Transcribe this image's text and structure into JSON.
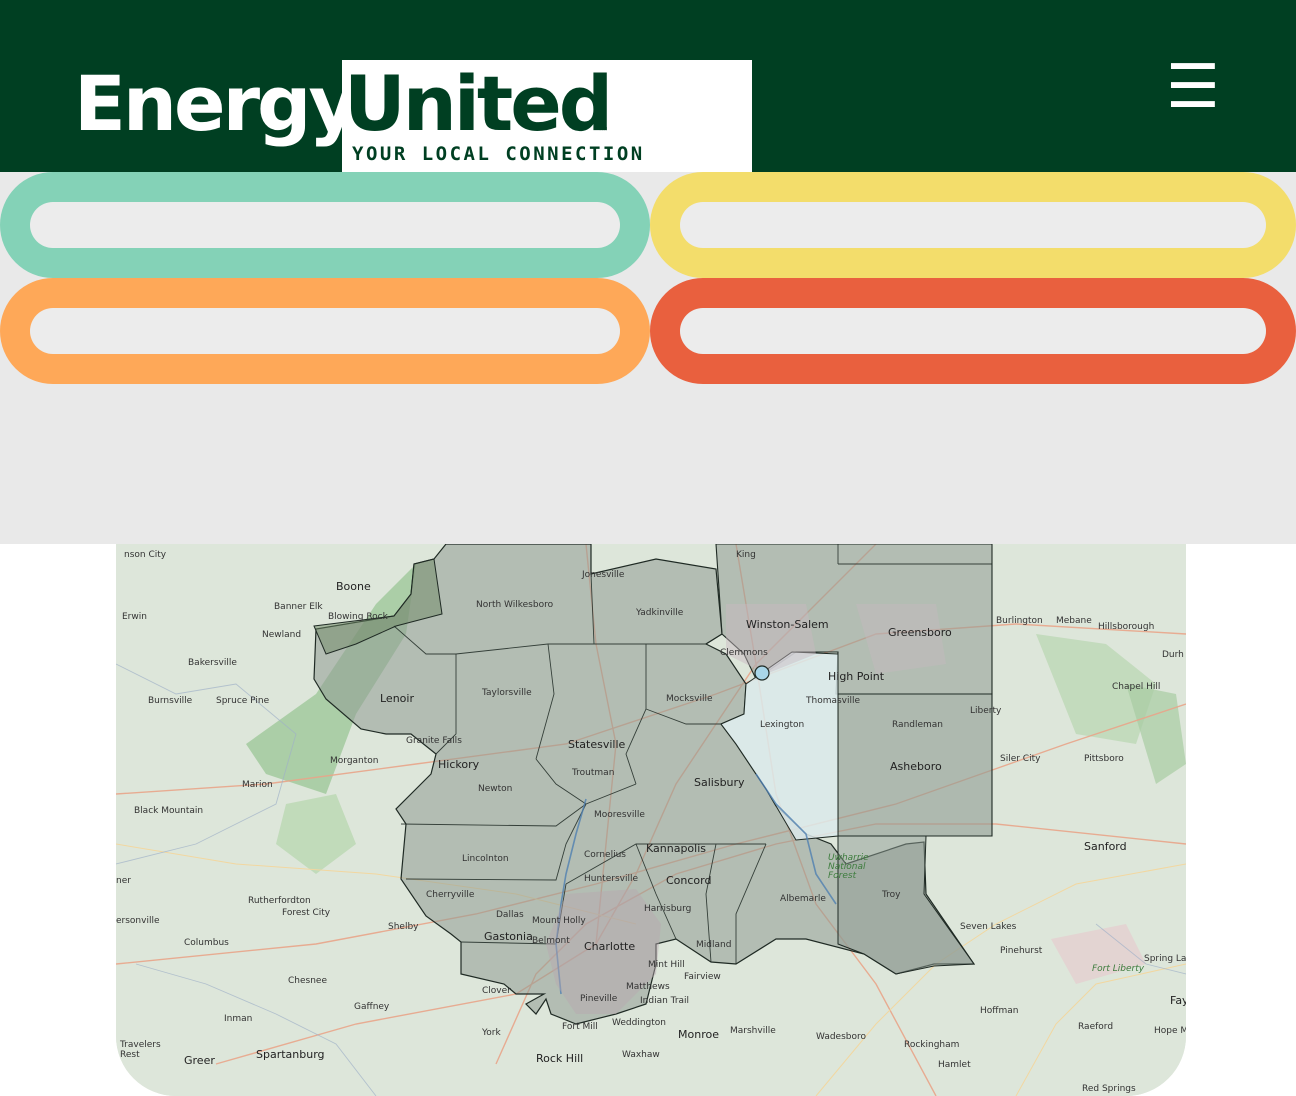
{
  "header": {
    "logo_energy": "Energy",
    "logo_united": "United",
    "logo_tm": "™",
    "tagline": "YOUR LOCAL CONNECTION",
    "menu_icon": "☰"
  },
  "colors": {
    "header_bg": "#003f22",
    "pill_teal": "#84d2b7",
    "pill_yellow": "#f3dd6b",
    "pill_orange": "#fea858",
    "pill_red": "#e9603e"
  },
  "search_fields": [
    {
      "value": "",
      "placeholder": ""
    },
    {
      "value": "",
      "placeholder": ""
    },
    {
      "value": "",
      "placeholder": ""
    },
    {
      "value": "",
      "placeholder": ""
    }
  ],
  "map": {
    "labels": [
      "nson City",
      "Boone",
      "Banner Elk",
      "Blowing Rock",
      "Erwin",
      "Newland",
      "Bakersville",
      "Burnsville",
      "Spruce Pine",
      "Lenoir",
      "Granite Falls",
      "Morganton",
      "Marion",
      "Black Mountain",
      "Hickory",
      "Newton",
      "Taylorsville",
      "Statesville",
      "Troutman",
      "Mooresville",
      "Cornelius",
      "Huntersville",
      "Lincolnton",
      "Cherryville",
      "Dallas",
      "Gastonia",
      "Mount Holly",
      "Belmont",
      "Charlotte",
      "Mint Hill",
      "Matthews",
      "Pineville",
      "Indian Trail",
      "Fort Mill",
      "Weddington",
      "Waxhaw",
      "Monroe",
      "Marshville",
      "Wadesboro",
      "Rockingham",
      "Hamlet",
      "Rock Hill",
      "York",
      "Clover",
      "Gaffney",
      "Shelby",
      "Spartanburg",
      "Greer",
      "Inman",
      "Chesnee",
      "Columbus",
      "Forest City",
      "Rutherfordton",
      "Jonesville",
      "North Wilkesboro",
      "Yadkinville",
      "King",
      "Winston-Salem",
      "Clemmons",
      "Mocksville",
      "Lexington",
      "Thomasville",
      "High Point",
      "Greensboro",
      "Burlington",
      "Mebane",
      "Hillsborough",
      "Durh",
      "Chapel Hill",
      "Randleman",
      "Liberty",
      "Asheboro",
      "Siler City",
      "Pittsboro",
      "Salisbury",
      "Kannapolis",
      "Concord",
      "Harrisburg",
      "Albemarle",
      "Midland",
      "Fairview",
      "Troy",
      "Uwharrie National Forest",
      "Seven Lakes",
      "Pinehurst",
      "Sanford",
      "Fort Liberty",
      "Spring Lake",
      "Fay",
      "Hoffman",
      "Raeford",
      "Hope M",
      "Red Springs",
      "Travelers Rest",
      "ersonville",
      "ner"
    ]
  }
}
